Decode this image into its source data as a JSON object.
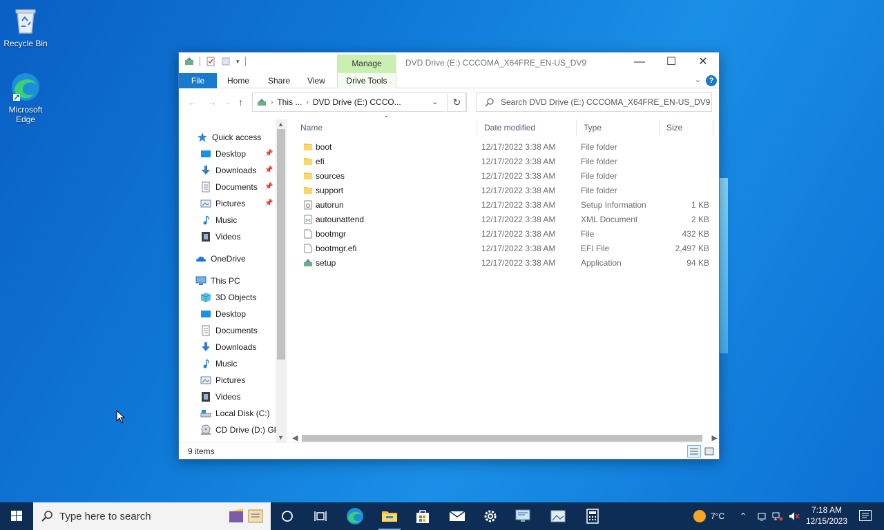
{
  "desktop": {
    "icons": [
      {
        "label": "Recycle Bin"
      },
      {
        "label": "Microsoft Edge"
      }
    ]
  },
  "window": {
    "title": "DVD Drive (E:) CCCOMA_X64FRE_EN-US_DV9",
    "contextual_tab": "Manage",
    "ribbon_tabs": [
      "File",
      "Home",
      "Share",
      "View",
      "Drive Tools"
    ],
    "address_parts": [
      "This ...",
      "DVD Drive (E:) CCCO..."
    ],
    "search_placeholder": "Search DVD Drive (E:) CCCOMA_X64FRE_EN-US_DV9",
    "status": "9 items"
  },
  "navpane": {
    "quick_access": "Quick access",
    "quick_items": [
      "Desktop",
      "Downloads",
      "Documents",
      "Pictures",
      "Music",
      "Videos"
    ],
    "onedrive": "OneDrive",
    "this_pc": "This PC",
    "pc_items": [
      "3D Objects",
      "Desktop",
      "Documents",
      "Downloads",
      "Music",
      "Pictures",
      "Videos",
      "Local Disk (C:)",
      "CD Drive (D:) GP"
    ]
  },
  "columns": {
    "name": "Name",
    "date": "Date modified",
    "type": "Type",
    "size": "Size"
  },
  "files": [
    {
      "name": "boot",
      "date": "12/17/2022 3:38 AM",
      "type": "File folder",
      "size": "",
      "icon": "folder-icon"
    },
    {
      "name": "efi",
      "date": "12/17/2022 3:38 AM",
      "type": "File folder",
      "size": "",
      "icon": "folder-icon"
    },
    {
      "name": "sources",
      "date": "12/17/2022 3:38 AM",
      "type": "File folder",
      "size": "",
      "icon": "folder-icon"
    },
    {
      "name": "support",
      "date": "12/17/2022 3:38 AM",
      "type": "File folder",
      "size": "",
      "icon": "folder-icon"
    },
    {
      "name": "autorun",
      "date": "12/17/2022 3:38 AM",
      "type": "Setup Information",
      "size": "1 KB",
      "icon": "setup-info-icon"
    },
    {
      "name": "autounattend",
      "date": "12/17/2022 3:38 AM",
      "type": "XML Document",
      "size": "2 KB",
      "icon": "xml-file-icon"
    },
    {
      "name": "bootmgr",
      "date": "12/17/2022 3:38 AM",
      "type": "File",
      "size": "432 KB",
      "icon": "file-icon"
    },
    {
      "name": "bootmgr.efi",
      "date": "12/17/2022 3:38 AM",
      "type": "EFI File",
      "size": "2,497 KB",
      "icon": "file-icon"
    },
    {
      "name": "setup",
      "date": "12/17/2022 3:38 AM",
      "type": "Application",
      "size": "94 KB",
      "icon": "setup-app-icon"
    }
  ],
  "taskbar": {
    "search_placeholder": "Type here to search",
    "weather": "7°C",
    "time": "7:18 AM",
    "date": "12/15/2023"
  }
}
